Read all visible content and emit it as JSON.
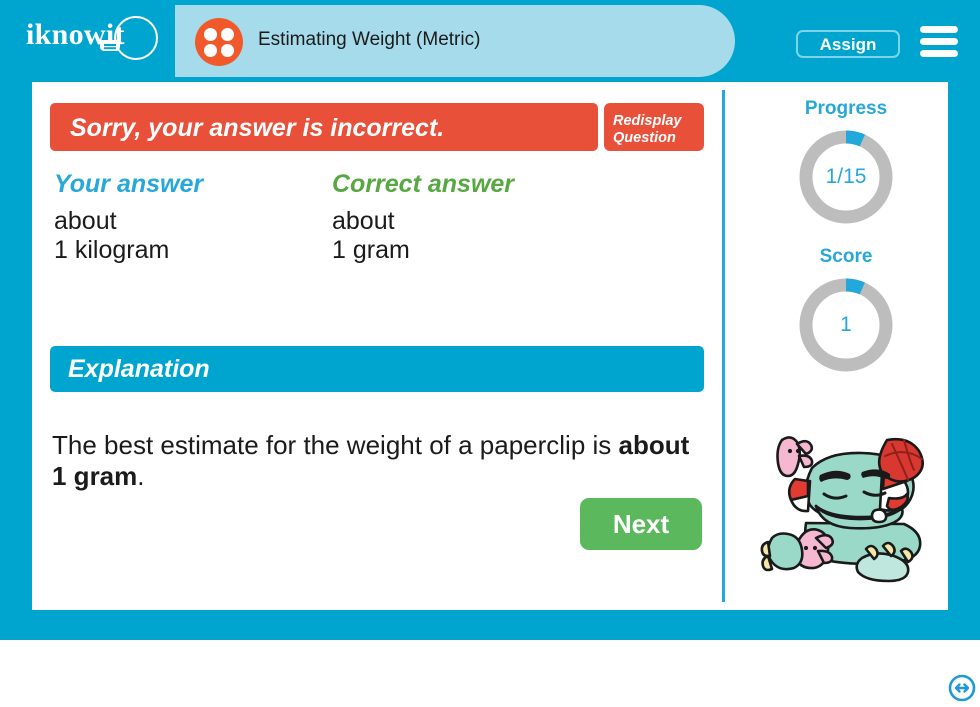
{
  "header": {
    "logo_text": "iknowit",
    "logo_icon": "lightbulb-icon",
    "topic_icon": "four-dots-icon",
    "title": "Estimating Weight (Metric)",
    "assign_label": "Assign",
    "menu_icon": "hamburger-menu-icon"
  },
  "feedback": {
    "message": "Sorry, your answer is incorrect.",
    "status": "incorrect",
    "banner_color": "#e8503a",
    "redisplay_line1": "Redisplay",
    "redisplay_line2": "Question"
  },
  "answers": {
    "your_heading": "Your answer",
    "your_heading_color": "#27a8d8",
    "your_value": "about\n1 kilogram",
    "correct_heading": "Correct answer",
    "correct_heading_color": "#57a843",
    "correct_value": "about\n1 gram"
  },
  "explanation": {
    "heading": "Explanation",
    "text_before": "The best estimate for the weight of a paperclip is ",
    "text_bold": "about 1 gram",
    "text_after": "."
  },
  "actions": {
    "next_label": "Next",
    "next_color": "#5cb85c"
  },
  "sidebar": {
    "progress": {
      "label": "Progress",
      "value": "1/15",
      "current": 1,
      "total": 15,
      "percent": 6.7,
      "arc_color": "#22a8da",
      "track_color": "#bdbdbd"
    },
    "score": {
      "label": "Score",
      "value": "1",
      "percent": 6.7,
      "arc_color": "#22a8da",
      "track_color": "#bdbdbd"
    },
    "mascot_icon": "cartoon-mascot-illustration",
    "resize_icon": "horizontal-resize-icon"
  },
  "theme": {
    "frame_blue": "#00a5cf",
    "pill_blue": "#a5dbea",
    "orange": "#f1592a",
    "divider_blue": "#22a8da"
  }
}
